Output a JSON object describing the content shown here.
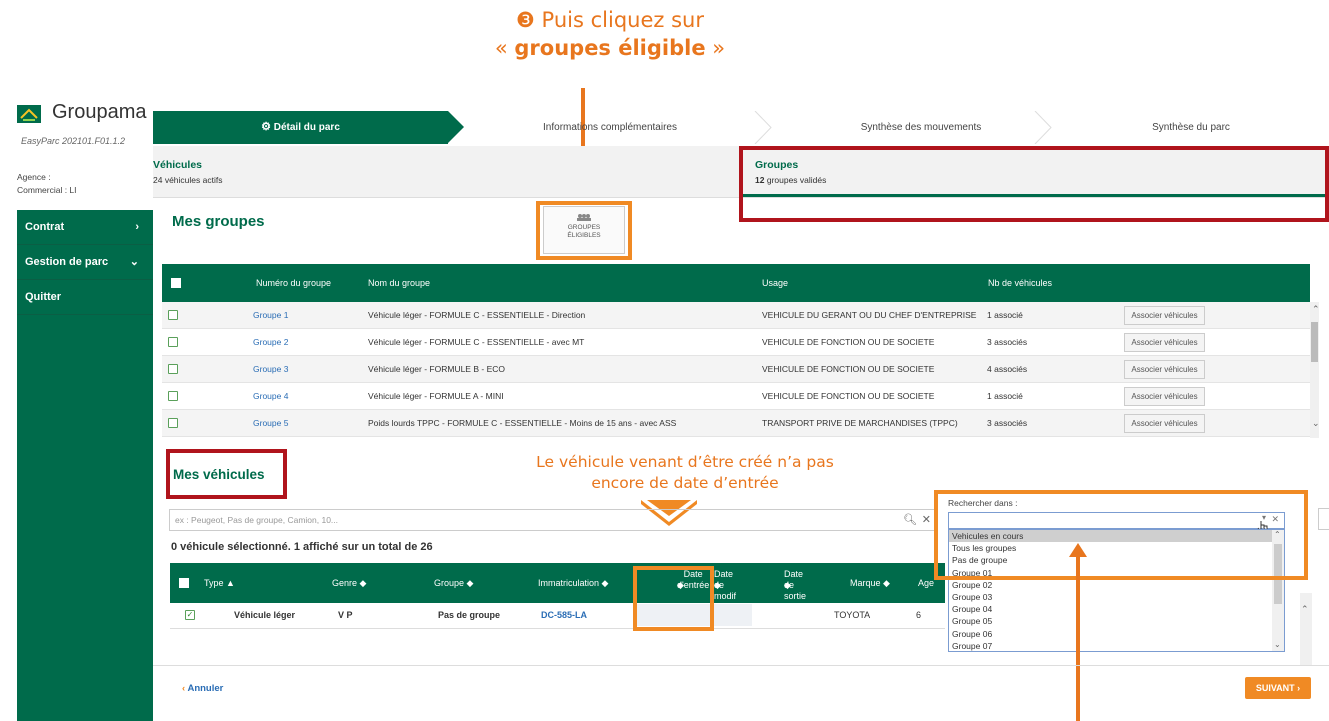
{
  "annotation": {
    "step_marker": "❸",
    "line1": "Puis cliquez sur",
    "line2_prefix": "«",
    "line2_bold": "groupes éligible",
    "line2_suffix": "»",
    "note_line1": "Le véhicule venant d’être créé n’a pas",
    "note_line2": "encore de date d’entrée"
  },
  "brand": {
    "name": "Groupama",
    "version": "EasyParc 202101.F01.1.2"
  },
  "steps": [
    {
      "label": "Détail du parc",
      "active": true
    },
    {
      "label": "Informations complémentaires",
      "active": false
    },
    {
      "label": "Synthèse des mouvements",
      "active": false
    },
    {
      "label": "Synthèse du parc",
      "active": false
    }
  ],
  "subtabs": {
    "vehicles": {
      "title": "Véhicules",
      "desc": "24 véhicules actifs"
    },
    "groups": {
      "title": "Groupes",
      "desc_bold": "12",
      "desc": "groupes validés"
    }
  },
  "agent": {
    "agence": "Agence :",
    "commercial": "Commercial : LI"
  },
  "sidebar": [
    {
      "label": "Contrat",
      "chevron": "›"
    },
    {
      "label": "Gestion de parc",
      "chevron": "⌄"
    },
    {
      "label": "Quitter",
      "chevron": ""
    }
  ],
  "groups_section": {
    "title": "Mes groupes",
    "eligible_button": {
      "line1": "GROUPES",
      "line2": "ÉLIGIBLES"
    },
    "headers": {
      "num": "Numéro du groupe",
      "name": "Nom du groupe",
      "usage": "Usage",
      "count": "Nb de véhicules"
    },
    "assoc_label": "Associer véhicules",
    "rows": [
      {
        "num": "Groupe 1",
        "name": "Véhicule léger - FORMULE C - ESSENTIELLE - Direction",
        "usage": "VEHICULE DU GERANT OU DU CHEF D'ENTREPRISE",
        "count": "1 associé"
      },
      {
        "num": "Groupe 2",
        "name": "Véhicule léger - FORMULE C - ESSENTIELLE - avec MT",
        "usage": "VEHICULE DE FONCTION OU DE SOCIETE",
        "count": "3 associés"
      },
      {
        "num": "Groupe 3",
        "name": "Véhicule léger - FORMULE B - ECO",
        "usage": "VEHICULE DE FONCTION OU DE SOCIETE",
        "count": "4 associés"
      },
      {
        "num": "Groupe 4",
        "name": "Véhicule léger - FORMULE A - MINI",
        "usage": "VEHICULE DE FONCTION OU DE SOCIETE",
        "count": "1 associé"
      },
      {
        "num": "Groupe 5",
        "name": "Poids lourds TPPC - FORMULE C - ESSENTIELLE - Moins de 15 ans - avec ASS",
        "usage": "TRANSPORT PRIVE DE MARCHANDISES (TPPC)",
        "count": "3 associés"
      }
    ]
  },
  "vehicles_section": {
    "title": "Mes véhicules",
    "search_placeholder": "ex : Peugeot, Pas de groupe, Camion, 10...",
    "count_line": "0 véhicule sélectionné. 1 affiché sur un total de 26",
    "headers": {
      "type": "Type ▲",
      "genre": "Genre ◆",
      "groupe": "Groupe ◆",
      "immat": "Immatriculation ◆",
      "date_entree": "Date d'entrée",
      "date_modif": "Date de modif",
      "date_sortie": "Date de sortie",
      "marque": "Marque ◆",
      "age": "Age",
      "sort_glyph": "◆"
    },
    "row": {
      "type": "Véhicule léger",
      "genre": "V P",
      "groupe": "Pas de groupe",
      "immat": "DC-585-LA",
      "marque": "TOYOTA",
      "age": "6"
    }
  },
  "search_in": {
    "label": "Rechercher dans :",
    "options": [
      "Vehicules en cours",
      "Tous les groupes",
      "Pas de groupe",
      "Groupe 01",
      "Groupe 02",
      "Groupe 03",
      "Groupe 04",
      "Groupe 05",
      "Groupe 06",
      "Groupe 07"
    ]
  },
  "footer": {
    "cancel": "Annuler",
    "next": "SUIVANT"
  },
  "colors": {
    "brand_green": "#006b4b",
    "annotation_orange": "#e8761e",
    "highlight_red": "#b0141c",
    "link_blue": "#2a6db5"
  }
}
